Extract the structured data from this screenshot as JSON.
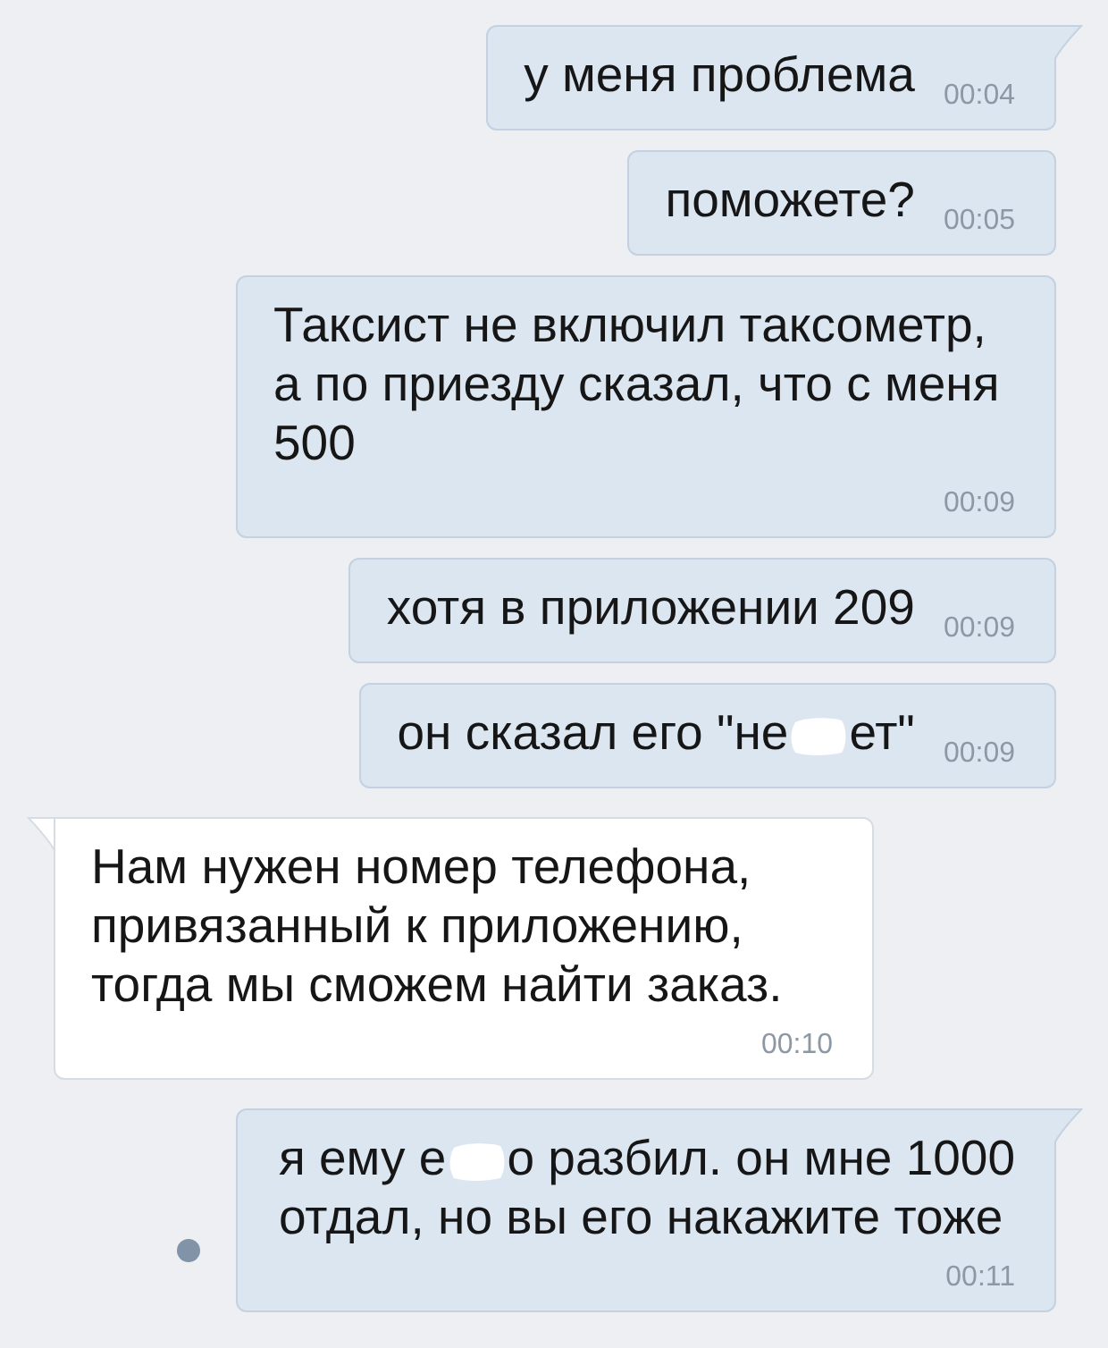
{
  "messages": [
    {
      "kind": "outgoing",
      "tail": true,
      "unread": false,
      "text": "у меня проблема",
      "time": "00:04"
    },
    {
      "kind": "outgoing",
      "tail": false,
      "unread": false,
      "text": "поможете?",
      "time": "00:05"
    },
    {
      "kind": "outgoing",
      "tail": false,
      "unread": false,
      "text": "Таксист не включил таксометр, а по приезду сказал, что с меня 500",
      "time": "00:09"
    },
    {
      "kind": "outgoing",
      "tail": false,
      "unread": false,
      "text": "хотя в приложении 209",
      "time": "00:09"
    },
    {
      "kind": "outgoing",
      "tail": false,
      "unread": false,
      "lines": [
        [
          {
            "kind": "text",
            "text": "он сказал его \"не"
          },
          {
            "kind": "redaction"
          },
          {
            "kind": "text",
            "text": "ет\""
          }
        ]
      ],
      "time": "00:09"
    },
    {
      "kind": "incoming",
      "tail": true,
      "unread": false,
      "text": "Нам нужен номер телефона, привязанный к приложению, тогда мы сможем найти заказ.",
      "time": "00:10"
    },
    {
      "kind": "outgoing",
      "tail": true,
      "unread": true,
      "lines": [
        [
          {
            "kind": "text",
            "text": "я ему е"
          },
          {
            "kind": "redaction"
          },
          {
            "kind": "text",
            "text": "о разбил. он мне 1000"
          }
        ],
        [
          {
            "kind": "text",
            "text": "отдал, но вы его накажите тоже"
          }
        ]
      ],
      "time": "00:11"
    }
  ]
}
